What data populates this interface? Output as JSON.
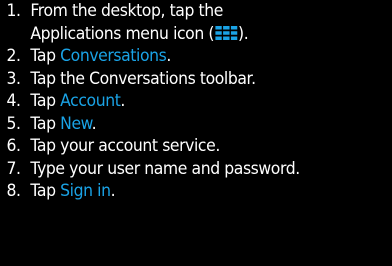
{
  "steps": [
    {
      "num": "1.",
      "line1": "From the desktop, tap the",
      "line2_before": "Applications menu icon (",
      "icon": "applications-menu-icon",
      "line2_after": ")."
    },
    {
      "num": "2.",
      "before": "Tap ",
      "link": "Conversations",
      "after": "."
    },
    {
      "num": "3.",
      "text": "Tap the Conversations toolbar."
    },
    {
      "num": "4.",
      "before": "Tap ",
      "link": "Account",
      "after": "."
    },
    {
      "num": "5.",
      "before": "Tap ",
      "link": "New",
      "after": "."
    },
    {
      "num": "6.",
      "text": "Tap your account service."
    },
    {
      "num": "7.",
      "text": "Type your user name and password."
    },
    {
      "num": "8.",
      "before": "Tap ",
      "link": "Sign in",
      "after": "."
    }
  ],
  "colors": {
    "background": "#000000",
    "text": "#ffffff",
    "link": "#1aa3e6",
    "icon": "#1aa3e6"
  }
}
